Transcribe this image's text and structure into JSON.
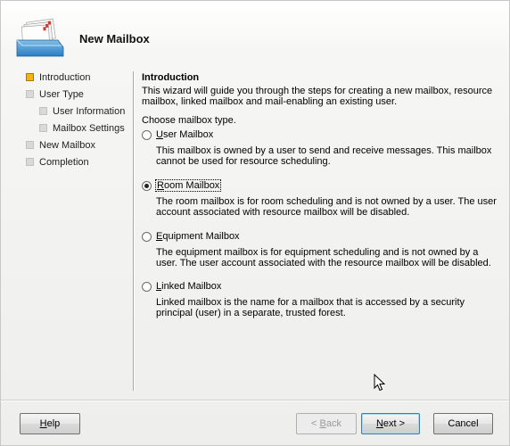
{
  "header": {
    "title": "New Mailbox"
  },
  "nav": {
    "items": [
      {
        "label": "Introduction",
        "sub": false,
        "active": true
      },
      {
        "label": "User Type",
        "sub": false,
        "active": false
      },
      {
        "label": "User Information",
        "sub": true,
        "active": false
      },
      {
        "label": "Mailbox Settings",
        "sub": true,
        "active": false
      },
      {
        "label": "New Mailbox",
        "sub": false,
        "active": false
      },
      {
        "label": "Completion",
        "sub": false,
        "active": false
      }
    ]
  },
  "content": {
    "section_title": "Introduction",
    "intro_text": "This wizard will guide you through the steps for creating a new mailbox, resource mailbox, linked mailbox and mail-enabling an existing user.",
    "choose_label": "Choose mailbox type.",
    "options": [
      {
        "label": "User Mailbox",
        "accel": "U",
        "rest": "ser Mailbox",
        "checked": false,
        "description": "This mailbox is owned by a user to send and receive messages. This mailbox cannot be used for resource scheduling."
      },
      {
        "label": "Room Mailbox",
        "accel": "R",
        "rest": "oom Mailbox",
        "checked": true,
        "description": "The room mailbox is for room scheduling and is not owned by a user. The user account associated with resource mailbox will be disabled."
      },
      {
        "label": "Equipment Mailbox",
        "accel": "E",
        "rest": "quipment Mailbox",
        "checked": false,
        "description": "The equipment mailbox is for equipment scheduling and is not owned by a user. The user account associated with the resource mailbox will be disabled."
      },
      {
        "label": "Linked Mailbox",
        "accel": "L",
        "rest": "inked Mailbox",
        "checked": false,
        "description": "Linked mailbox is the name for a mailbox that is accessed by a security principal (user) in a separate, trusted forest."
      }
    ]
  },
  "buttons": {
    "help": {
      "accel": "H",
      "rest": "elp"
    },
    "back": {
      "prefix": "< ",
      "accel": "B",
      "rest": "ack"
    },
    "next": {
      "accel": "N",
      "rest": "ext >"
    },
    "cancel": {
      "label": "Cancel"
    }
  },
  "colors": {
    "active_step": "#f3b311",
    "inactive_step": "#d9d9d9",
    "default_button_border": "#3c7fb1"
  }
}
